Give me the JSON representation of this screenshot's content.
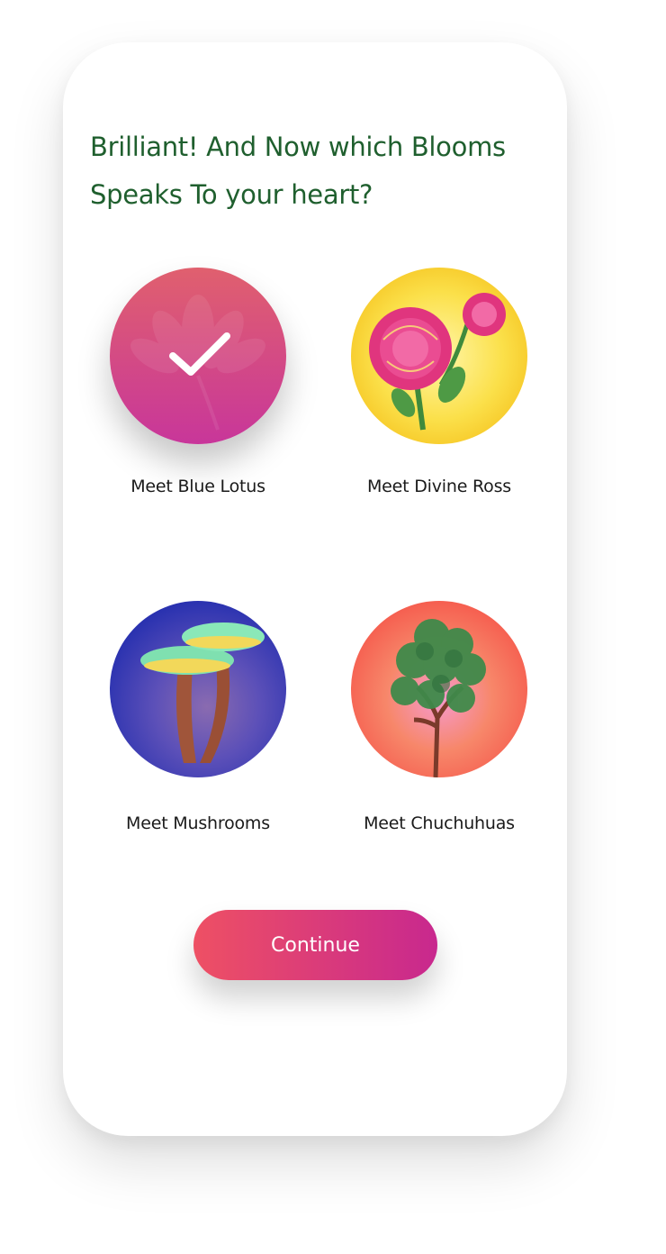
{
  "question": {
    "title": "Brilliant! And Now which Blooms Speaks To your heart?"
  },
  "options": [
    {
      "label": "Meet Blue Lotus",
      "selected": true,
      "icon": "blue-lotus-illustration"
    },
    {
      "label": "Meet Divine Ross",
      "selected": false,
      "icon": "rose-illustration"
    },
    {
      "label": "Meet Mushrooms",
      "selected": false,
      "icon": "mushrooms-illustration"
    },
    {
      "label": "Meet Chuchuhuas",
      "selected": false,
      "icon": "tree-illustration"
    }
  ],
  "actions": {
    "continue_label": "Continue"
  },
  "colors": {
    "title": "#1f5f2e",
    "button_start": "#ee5064",
    "button_end": "#c8288e",
    "selected_start": "#e05a78",
    "selected_end": "#c8369a"
  }
}
